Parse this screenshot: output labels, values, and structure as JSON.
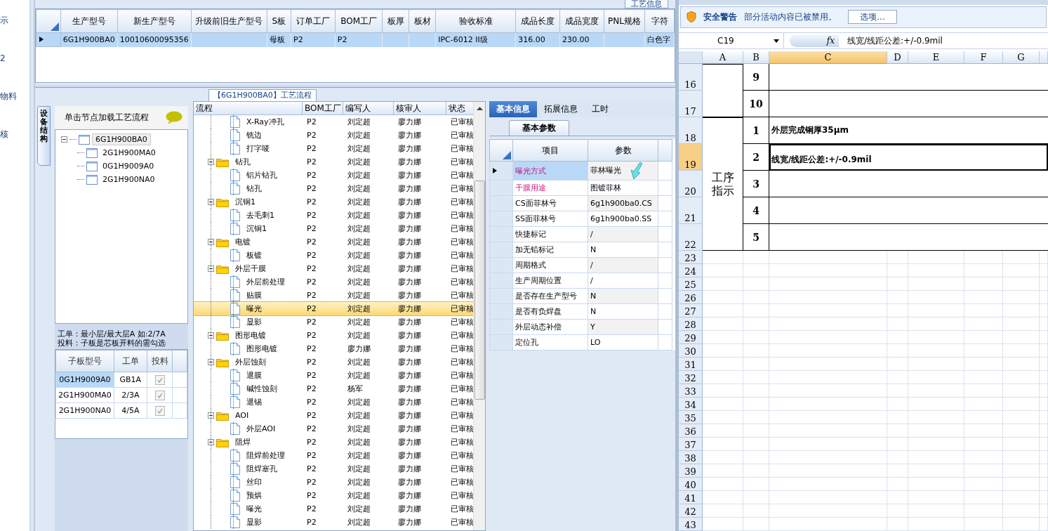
{
  "sidebar": {
    "items": [
      "示",
      "2",
      "物料",
      "核"
    ]
  },
  "top_button": "工艺信息",
  "product_table": {
    "columns": [
      "生产型号",
      "新生产型号",
      "升级前旧生产型号",
      "S板",
      "订单工厂",
      "BOM工厂",
      "板厚",
      "板材",
      "验收标准",
      "成品长度",
      "成品宽度",
      "PNL规格",
      "字符"
    ],
    "rows": [
      {
        "selected": true,
        "cells": [
          "6G1H900BA0",
          "10010600095356",
          "",
          "母板",
          "P2",
          "P2",
          "",
          "",
          "IPC-6012 II级",
          "316.00",
          "230.00",
          "",
          "白色字"
        ]
      }
    ]
  },
  "flow_panel": {
    "title": "【6G1H900BA0】工艺流程"
  },
  "structure": {
    "side_tab": "设备结构",
    "hint": "单击节点加载工艺流程",
    "tree": [
      {
        "label": "6G1H900BA0",
        "expanded": true,
        "selected": true,
        "children": [
          {
            "label": "2G1H900MA0",
            "selected": false
          },
          {
            "label": "0G1H9009A0",
            "selected": false
          },
          {
            "label": "2G1H900NA0",
            "selected": false
          }
        ]
      }
    ],
    "notes": [
      "工单：最小层/最大层A 如:2/7A",
      "投料：子板是芯板开料的需勾选"
    ],
    "sub_table": {
      "columns": [
        "子板型号",
        "工单",
        "投料"
      ],
      "rows": [
        {
          "model": "0G1H9009A0",
          "order": "GB1A",
          "checked": true,
          "selected": true
        },
        {
          "model": "2G1H900MA0",
          "order": "2/3A",
          "checked": true,
          "selected": false
        },
        {
          "model": "2G1H900NA0",
          "order": "4/5A",
          "checked": true,
          "selected": false
        }
      ]
    }
  },
  "flow": {
    "columns": [
      "流程",
      "BOM工厂",
      "编写人",
      "核审人",
      "状态"
    ],
    "rows": [
      {
        "kind": "group",
        "children": [
          {
            "kind": "step",
            "name": "X-Ray冲孔",
            "factory": "P2",
            "author": "刘定超",
            "reviewer": "廖力娜",
            "status": "已审核",
            "selected": false
          },
          {
            "kind": "step",
            "name": "铣边",
            "factory": "P2",
            "author": "刘定超",
            "reviewer": "廖力娜",
            "status": "已审核",
            "selected": false
          },
          {
            "kind": "step",
            "name": "打字唛",
            "factory": "P2",
            "author": "刘定超",
            "reviewer": "廖力娜",
            "status": "已审核",
            "selected": false
          }
        ]
      },
      {
        "kind": "group",
        "name": "钻孔",
        "factory": "P2",
        "author": "刘定超",
        "reviewer": "廖力娜",
        "status": "已审核",
        "selected": false,
        "expanded": true,
        "children": [
          {
            "kind": "step",
            "name": "铝片钻孔",
            "factory": "P2",
            "author": "刘定超",
            "reviewer": "廖力娜",
            "status": "已审核",
            "selected": false
          },
          {
            "kind": "step",
            "name": "钻孔",
            "factory": "P2",
            "author": "刘定超",
            "reviewer": "廖力娜",
            "status": "已审核",
            "selected": false
          }
        ]
      },
      {
        "kind": "group",
        "name": "沉铜1",
        "factory": "P2",
        "author": "刘定超",
        "reviewer": "廖力娜",
        "status": "已审核",
        "selected": false,
        "expanded": true,
        "children": [
          {
            "kind": "step",
            "name": "去毛刺1",
            "factory": "P2",
            "author": "刘定超",
            "reviewer": "廖力娜",
            "status": "已审核",
            "selected": false
          },
          {
            "kind": "step",
            "name": "沉铜1",
            "factory": "P2",
            "author": "刘定超",
            "reviewer": "廖力娜",
            "status": "已审核",
            "selected": false
          }
        ]
      },
      {
        "kind": "group",
        "name": "电镀",
        "factory": "P2",
        "author": "刘定超",
        "reviewer": "廖力娜",
        "status": "已审核",
        "selected": false,
        "expanded": true,
        "children": [
          {
            "kind": "step",
            "name": "板镀",
            "factory": "P2",
            "author": "刘定超",
            "reviewer": "廖力娜",
            "status": "已审核",
            "selected": false
          }
        ]
      },
      {
        "kind": "group",
        "name": "外层干膜",
        "factory": "P2",
        "author": "刘定超",
        "reviewer": "廖力娜",
        "status": "已审核",
        "selected": false,
        "expanded": true,
        "children": [
          {
            "kind": "step",
            "name": "外层前处理",
            "factory": "P2",
            "author": "刘定超",
            "reviewer": "廖力娜",
            "status": "已审核",
            "selected": false
          },
          {
            "kind": "step",
            "name": "贴膜",
            "factory": "P2",
            "author": "刘定超",
            "reviewer": "廖力娜",
            "status": "已审核",
            "selected": false
          },
          {
            "kind": "step",
            "name": "曝光",
            "factory": "P2",
            "author": "刘定超",
            "reviewer": "廖力娜",
            "status": "已审核",
            "selected": true
          },
          {
            "kind": "step",
            "name": "显影",
            "factory": "P2",
            "author": "刘定超",
            "reviewer": "廖力娜",
            "status": "已审核",
            "selected": false
          }
        ]
      },
      {
        "kind": "group",
        "name": "图形电镀",
        "factory": "P2",
        "author": "刘定超",
        "reviewer": "廖力娜",
        "status": "已审核",
        "selected": false,
        "expanded": true,
        "children": [
          {
            "kind": "step",
            "name": "图形电镀",
            "factory": "P2",
            "author": "廖力娜",
            "reviewer": "廖力娜",
            "status": "已审核",
            "selected": false
          }
        ]
      },
      {
        "kind": "group",
        "name": "外层蚀刻",
        "factory": "P2",
        "author": "刘定超",
        "reviewer": "廖力娜",
        "status": "已审核",
        "selected": false,
        "expanded": true,
        "children": [
          {
            "kind": "step",
            "name": "退膜",
            "factory": "P2",
            "author": "刘定超",
            "reviewer": "廖力娜",
            "status": "已审核",
            "selected": false
          },
          {
            "kind": "step",
            "name": "碱性蚀刻",
            "factory": "P2",
            "author": "杨军",
            "reviewer": "廖力娜",
            "status": "已审核",
            "selected": false
          },
          {
            "kind": "step",
            "name": "退锡",
            "factory": "P2",
            "author": "刘定超",
            "reviewer": "廖力娜",
            "status": "已审核",
            "selected": false
          }
        ]
      },
      {
        "kind": "group",
        "name": "AOI",
        "factory": "P2",
        "author": "刘定超",
        "reviewer": "廖力娜",
        "status": "已审核",
        "selected": false,
        "expanded": true,
        "children": [
          {
            "kind": "step",
            "name": "外层AOI",
            "factory": "P2",
            "author": "刘定超",
            "reviewer": "廖力娜",
            "status": "已审核",
            "selected": false
          }
        ]
      },
      {
        "kind": "group",
        "name": "阻焊",
        "factory": "P2",
        "author": "刘定超",
        "reviewer": "廖力娜",
        "status": "已审核",
        "selected": false,
        "expanded": true,
        "children": [
          {
            "kind": "step",
            "name": "阻焊前处理",
            "factory": "P2",
            "author": "刘定超",
            "reviewer": "廖力娜",
            "status": "已审核",
            "selected": false
          },
          {
            "kind": "step",
            "name": "阻焊塞孔",
            "factory": "P2",
            "author": "刘定超",
            "reviewer": "廖力娜",
            "status": "已审核",
            "selected": false
          },
          {
            "kind": "step",
            "name": "丝印",
            "factory": "P2",
            "author": "刘定超",
            "reviewer": "廖力娜",
            "status": "已审核",
            "selected": false
          },
          {
            "kind": "step",
            "name": "预烘",
            "factory": "P2",
            "author": "刘定超",
            "reviewer": "廖力娜",
            "status": "已审核",
            "selected": false
          },
          {
            "kind": "step",
            "name": "曝光",
            "factory": "P2",
            "author": "刘定超",
            "reviewer": "廖力娜",
            "status": "已审核",
            "selected": false
          },
          {
            "kind": "step",
            "name": "显影",
            "factory": "P2",
            "author": "刘定超",
            "reviewer": "廖力娜",
            "status": "已审核",
            "selected": false
          }
        ]
      }
    ]
  },
  "details": {
    "tabs": [
      {
        "label": "基本信息",
        "selected": true
      },
      {
        "label": "拓展信息",
        "selected": false
      },
      {
        "label": "工时",
        "selected": false
      }
    ],
    "sub_tab": "基本参数",
    "columns": [
      "项目",
      "参数"
    ],
    "rows": [
      {
        "item": "曝光方式",
        "value": "菲林曝光",
        "highlighted": true,
        "selected": true
      },
      {
        "item": "干膜用途",
        "value": "图镀菲林",
        "highlighted": true,
        "selected": false
      },
      {
        "item": "CS面菲林号",
        "value": "6g1h900ba0.CS",
        "highlighted": false,
        "selected": false
      },
      {
        "item": "SS面菲林号",
        "value": "6g1h900ba0.SS",
        "highlighted": false,
        "selected": false
      },
      {
        "item": "快捷标记",
        "value": "/",
        "highlighted": false,
        "selected": false
      },
      {
        "item": "加无铅标记",
        "value": "N",
        "highlighted": false,
        "selected": false
      },
      {
        "item": "周期格式",
        "value": "/",
        "highlighted": false,
        "selected": false
      },
      {
        "item": "生产周期位置",
        "value": "/",
        "highlighted": false,
        "selected": false
      },
      {
        "item": "是否存在生产型号",
        "value": "N",
        "highlighted": false,
        "selected": false
      },
      {
        "item": "是否有负焊盘",
        "value": "N",
        "highlighted": false,
        "selected": false
      },
      {
        "item": "外层动态补偿",
        "value": "Y",
        "highlighted": false,
        "selected": false
      },
      {
        "item": "定位孔",
        "value": "LO",
        "highlighted": false,
        "selected": false
      }
    ]
  },
  "sheet": {
    "security": {
      "title": "安全警告",
      "message": "部分活动内容已被禁用。",
      "button": "选项..."
    },
    "name_box": "C19",
    "fx": "fx",
    "formula": "线宽/线距公差:+/-0.9mil",
    "columns": [
      {
        "label": "A",
        "selected": false
      },
      {
        "label": "B",
        "selected": false
      },
      {
        "label": "C",
        "selected": true
      },
      {
        "label": "D",
        "selected": false
      },
      {
        "label": "E",
        "selected": false
      },
      {
        "label": "F",
        "selected": false
      },
      {
        "label": "G",
        "selected": false
      }
    ],
    "blocks": [
      {
        "rows": [
          {
            "number": "16",
            "b": "9",
            "selected": false
          },
          {
            "number": "17",
            "b": "10",
            "selected": false
          }
        ]
      },
      {
        "label": "工序指示",
        "rows": [
          {
            "number": "18",
            "b": "1",
            "c": "外层完成铜厚35μm",
            "selected": false
          },
          {
            "number": "19",
            "b": "2",
            "c": "线宽/线距公差:+/-0.9mil",
            "selected": true
          },
          {
            "number": "20",
            "b": "3",
            "selected": false
          },
          {
            "number": "21",
            "b": "4",
            "selected": false
          },
          {
            "number": "22",
            "b": "5",
            "selected": false
          }
        ]
      }
    ],
    "empty_rows": [
      "23",
      "24",
      "25",
      "26",
      "27",
      "28",
      "29",
      "30",
      "31",
      "32",
      "33",
      "34",
      "35",
      "36",
      "37",
      "38",
      "39",
      "40",
      "41",
      "42",
      "43"
    ]
  }
}
